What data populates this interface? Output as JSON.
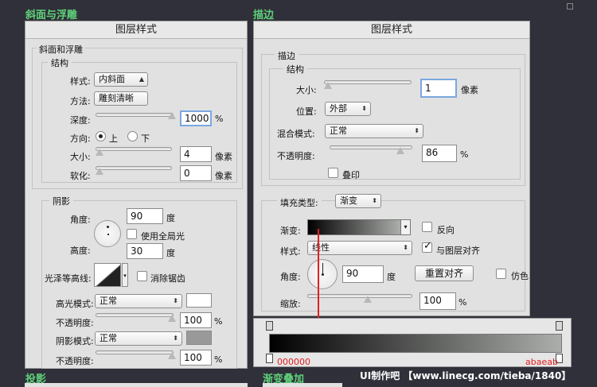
{
  "sections": {
    "bevel": "斜面与浮雕",
    "stroke": "描边",
    "shadow": "投影",
    "gradient_overlay": "渐变叠加"
  },
  "left_dialog": {
    "title": "图层样式",
    "group_title": "斜面和浮雕",
    "structure_title": "结构",
    "style_label": "样式:",
    "style_value": "内斜面",
    "method_label": "方法:",
    "method_value": "雕刻清晰",
    "depth_label": "深度:",
    "depth_value": "1000",
    "depth_unit": "%",
    "direction_label": "方向:",
    "dir_up": "上",
    "dir_down": "下",
    "size_label": "大小:",
    "size_value": "4",
    "size_unit": "像素",
    "soften_label": "软化:",
    "soften_value": "0",
    "soften_unit": "像素",
    "shading_title": "阴影",
    "angle_label": "角度:",
    "angle_value": "90",
    "angle_unit": "度",
    "global_light": "使用全局光",
    "altitude_label": "高度:",
    "altitude_value": "30",
    "altitude_unit": "度",
    "gloss_label": "光泽等高线:",
    "anti_alias": "消除锯齿",
    "highlight_label": "高光模式:",
    "highlight_value": "正常",
    "opacity_label_1": "不透明度:",
    "opacity_value_1": "100",
    "opacity_unit_1": "%",
    "shadow_mode_label": "阴影模式:",
    "shadow_mode_value": "正常",
    "opacity_label_2": "不透明度:",
    "opacity_value_2": "100",
    "opacity_unit_2": "%",
    "highlight_color": "#ffffff",
    "shadow_color": "#999999"
  },
  "right_dialog": {
    "title": "图层样式",
    "group_title": "描边",
    "structure_title": "结构",
    "size_label": "大小:",
    "size_value": "1",
    "size_unit": "像素",
    "position_label": "位置:",
    "position_value": "外部",
    "blend_label": "混合模式:",
    "blend_value": "正常",
    "opacity_label": "不透明度:",
    "opacity_value": "86",
    "opacity_unit": "%",
    "overprint": "叠印",
    "fill_type_label": "填充类型:",
    "fill_type_value": "渐变",
    "gradient_label": "渐变:",
    "reverse": "反向",
    "style_label": "样式:",
    "style_value": "线性",
    "align_layer": "与图层对齐",
    "angle_label": "角度:",
    "angle_value": "90",
    "angle_unit": "度",
    "reset_align": "重置对齐",
    "dither": "仿色",
    "scale_label": "缩放:",
    "scale_value": "100",
    "scale_unit": "%"
  },
  "gradient_editor": {
    "start_color_label": "000000",
    "end_color_label": "abaeab",
    "start_color": "#000000",
    "end_color": "#abaeab"
  },
  "watermark": "UI制作吧 【www.linecg.com/tieba/1840】",
  "colors": {
    "accent_green": "#5fd17a",
    "arrow_red": "#e02020",
    "label_red": "#e02020"
  }
}
